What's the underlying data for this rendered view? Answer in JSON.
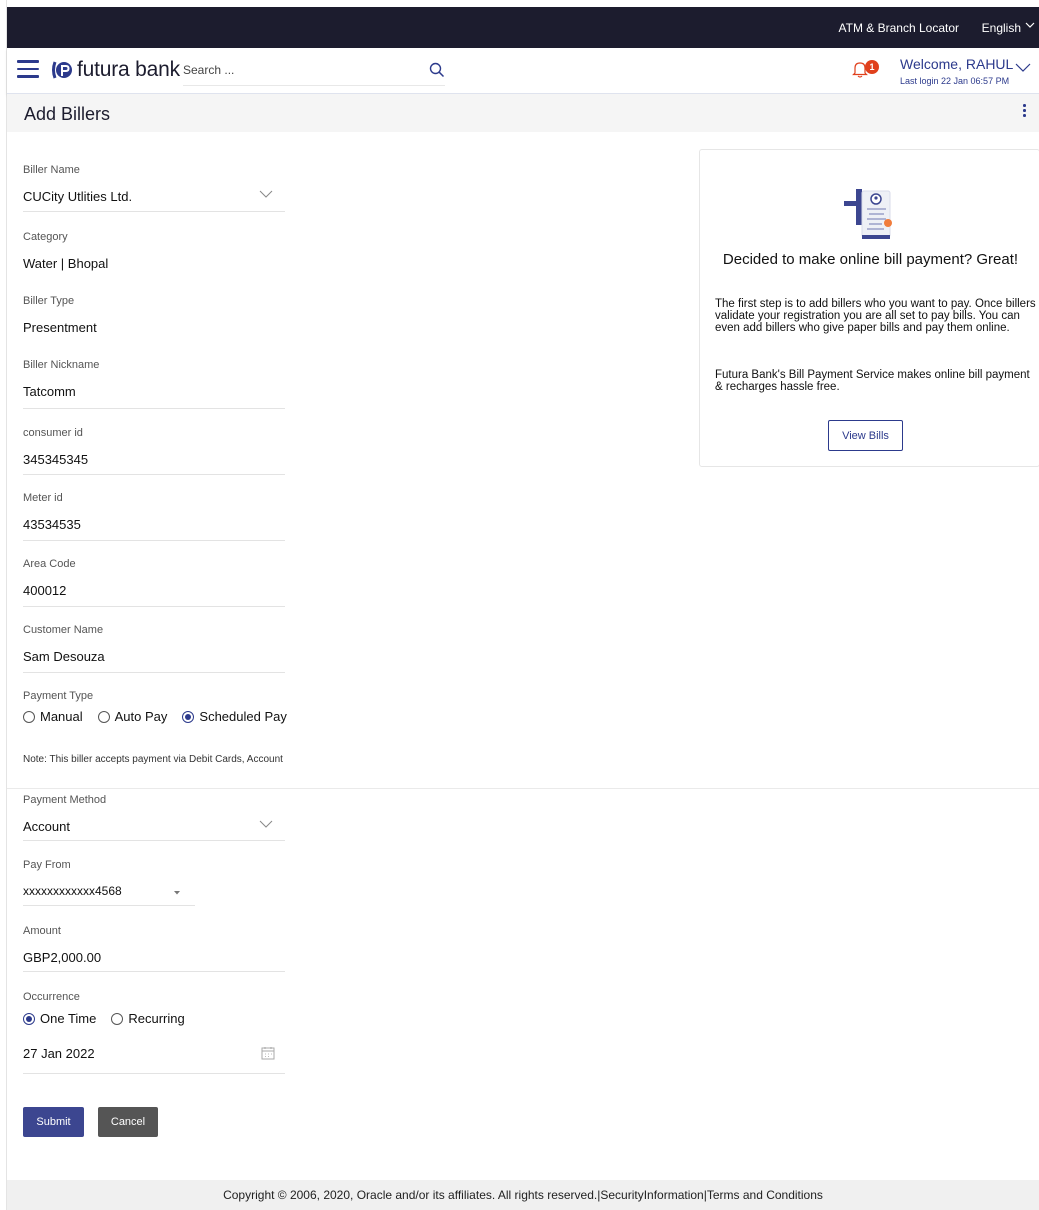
{
  "topbar": {
    "atm_locator": "ATM & Branch Locator",
    "language": "English"
  },
  "header": {
    "brand": "futura bank",
    "search_placeholder": "Search ...",
    "notification_count": "1",
    "welcome": "Welcome, RAHUL",
    "last_login": "Last login 22 Jan 06:57 PM"
  },
  "page": {
    "title": "Add Billers"
  },
  "form": {
    "biller_name": {
      "label": "Biller Name",
      "value": "CUCity Utlities Ltd."
    },
    "category": {
      "label": "Category",
      "value": "Water | Bhopal"
    },
    "biller_type": {
      "label": "Biller Type",
      "value": "Presentment"
    },
    "biller_nickname": {
      "label": "Biller Nickname",
      "value": "Tatcomm"
    },
    "consumer_id": {
      "label": "consumer id",
      "value": "345345345"
    },
    "meter_id": {
      "label": "Meter id",
      "value": "43534535"
    },
    "area_code": {
      "label": "Area Code",
      "value": "400012"
    },
    "customer_name": {
      "label": "Customer Name",
      "value": "Sam Desouza"
    },
    "payment_type": {
      "label": "Payment Type",
      "options": [
        "Manual",
        "Auto Pay",
        "Scheduled Pay"
      ],
      "selected": "Scheduled Pay"
    },
    "note": "Note: This biller accepts payment via Debit Cards, Account",
    "payment_method": {
      "label": "Payment Method",
      "value": "Account"
    },
    "pay_from": {
      "label": "Pay From",
      "value": "xxxxxxxxxxxx4568"
    },
    "amount": {
      "label": "Amount",
      "value": "GBP2,000.00"
    },
    "occurrence": {
      "label": "Occurrence",
      "options": [
        "One Time",
        "Recurring"
      ],
      "selected": "One Time"
    },
    "date": {
      "value": "27 Jan 2022"
    },
    "submit_label": "Submit",
    "cancel_label": "Cancel"
  },
  "info_card": {
    "heading": "Decided to make online bill payment? Great!",
    "para1": "The first step is to add billers who you want to pay. Once billers validate your registration you are all set to pay bills. You can even add billers who give paper bills and pay them online.",
    "para2": "Futura Bank's Bill Payment Service makes online bill payment & recharges hassle free.",
    "button": "View Bills"
  },
  "footer": {
    "text": "Copyright © 2006, 2020, Oracle and/or its affiliates. All rights reserved.|SecurityInformation|Terms and Conditions"
  },
  "colors": {
    "primary": "#2c3a8c",
    "topbar": "#1c1c2e",
    "badge": "#e0401c",
    "cancel": "#555555"
  }
}
